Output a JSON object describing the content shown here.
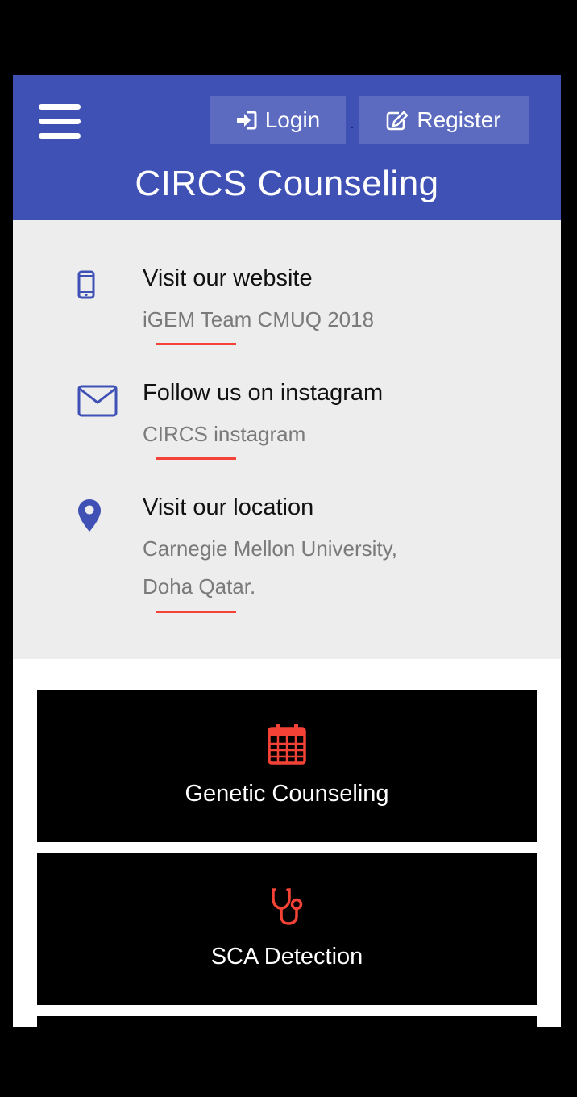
{
  "header": {
    "title": "CIRCS Counseling",
    "login_label": "Login",
    "register_label": "Register",
    "separator": "."
  },
  "contact": {
    "items": [
      {
        "icon": "mobile-phone-icon",
        "heading": "Visit our website",
        "lines": [
          "iGEM Team CMUQ 2018"
        ]
      },
      {
        "icon": "envelope-icon",
        "heading": "Follow us on instagram",
        "lines": [
          "CIRCS instagram"
        ]
      },
      {
        "icon": "map-marker-icon",
        "heading": "Visit our location",
        "lines": [
          "Carnegie Mellon University,",
          "Doha Qatar."
        ]
      }
    ]
  },
  "cards": [
    {
      "icon": "calendar-icon",
      "label": "Genetic Counseling"
    },
    {
      "icon": "stethoscope-icon",
      "label": "SCA Detection"
    }
  ],
  "colors": {
    "primary": "#3f51b5",
    "button": "#5c6bc0",
    "accent": "#f44336",
    "section_bg": "#ededed",
    "card_bg": "#000000"
  }
}
